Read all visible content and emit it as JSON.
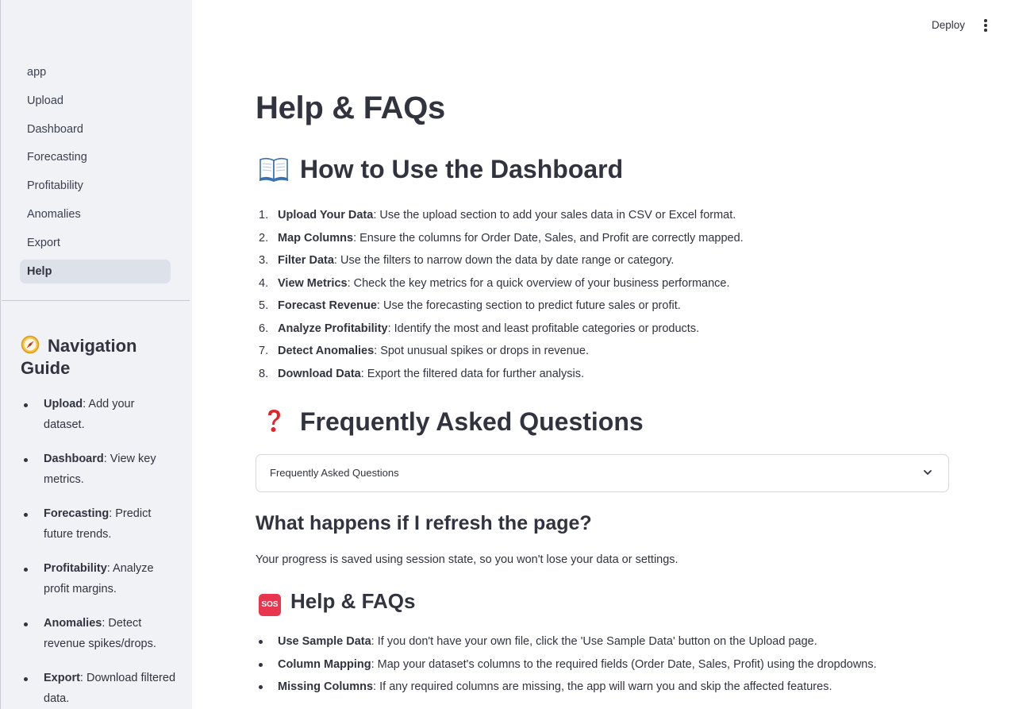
{
  "header": {
    "deploy_label": "Deploy",
    "menu_icon": "kebab-menu-icon"
  },
  "sidebar": {
    "items": [
      {
        "label": "app",
        "active": false
      },
      {
        "label": "Upload",
        "active": false
      },
      {
        "label": "Dashboard",
        "active": false
      },
      {
        "label": "Forecasting",
        "active": false
      },
      {
        "label": "Profitability",
        "active": false
      },
      {
        "label": "Anomalies",
        "active": false
      },
      {
        "label": "Export",
        "active": false
      },
      {
        "label": "Help",
        "active": true
      }
    ],
    "guide": {
      "title": "Navigation Guide",
      "icon": "compass-icon",
      "items": [
        {
          "name": "Upload",
          "desc": ": Add your dataset."
        },
        {
          "name": "Dashboard",
          "desc": ": View key metrics."
        },
        {
          "name": "Forecasting",
          "desc": ": Predict future trends."
        },
        {
          "name": "Profitability",
          "desc": ": Analyze profit margins."
        },
        {
          "name": "Anomalies",
          "desc": ": Detect revenue spikes/drops."
        },
        {
          "name": "Export",
          "desc": ": Download filtered data."
        }
      ]
    }
  },
  "main": {
    "title": "Help & FAQs",
    "how_to": {
      "heading": "How to Use the Dashboard",
      "icon": "book-icon",
      "steps": [
        {
          "num": "1.",
          "name": "Upload Your Data",
          "desc": ": Use the upload section to add your sales data in CSV or Excel format."
        },
        {
          "num": "2.",
          "name": "Map Columns",
          "desc": ": Ensure the columns for Order Date, Sales, and Profit are correctly mapped."
        },
        {
          "num": "3.",
          "name": "Filter Data",
          "desc": ": Use the filters to narrow down the data by date range or category."
        },
        {
          "num": "4.",
          "name": "View Metrics",
          "desc": ": Check the key metrics for a quick overview of your business performance."
        },
        {
          "num": "5.",
          "name": "Forecast Revenue",
          "desc": ": Use the forecasting section to predict future sales or profit."
        },
        {
          "num": "6.",
          "name": "Analyze Profitability",
          "desc": ": Identify the most and least profitable categories or products."
        },
        {
          "num": "7.",
          "name": "Detect Anomalies",
          "desc": ": Spot unusual spikes or drops in revenue."
        },
        {
          "num": "8.",
          "name": "Download Data",
          "desc": ": Export the filtered data for further analysis."
        }
      ]
    },
    "faq": {
      "heading": "Frequently Asked Questions",
      "icon": "question-mark-icon",
      "expander_label": "Frequently Asked Questions",
      "question": "What happens if I refresh the page?",
      "answer": "Your progress is saved using session state, so you won't lose your data or settings."
    },
    "help": {
      "heading": "Help & FAQs",
      "badge": "SOS",
      "items": [
        {
          "name": "Use Sample Data",
          "desc": ": If you don't have your own file, click the 'Use Sample Data' button on the Upload page."
        },
        {
          "name": "Column Mapping",
          "desc": ": Map your dataset's columns to the required fields (Order Date, Sales, Profit) using the dropdowns."
        },
        {
          "name": "Missing Columns",
          "desc": ": If any required columns are missing, the app will warn you and skip the affected features."
        }
      ]
    }
  }
}
